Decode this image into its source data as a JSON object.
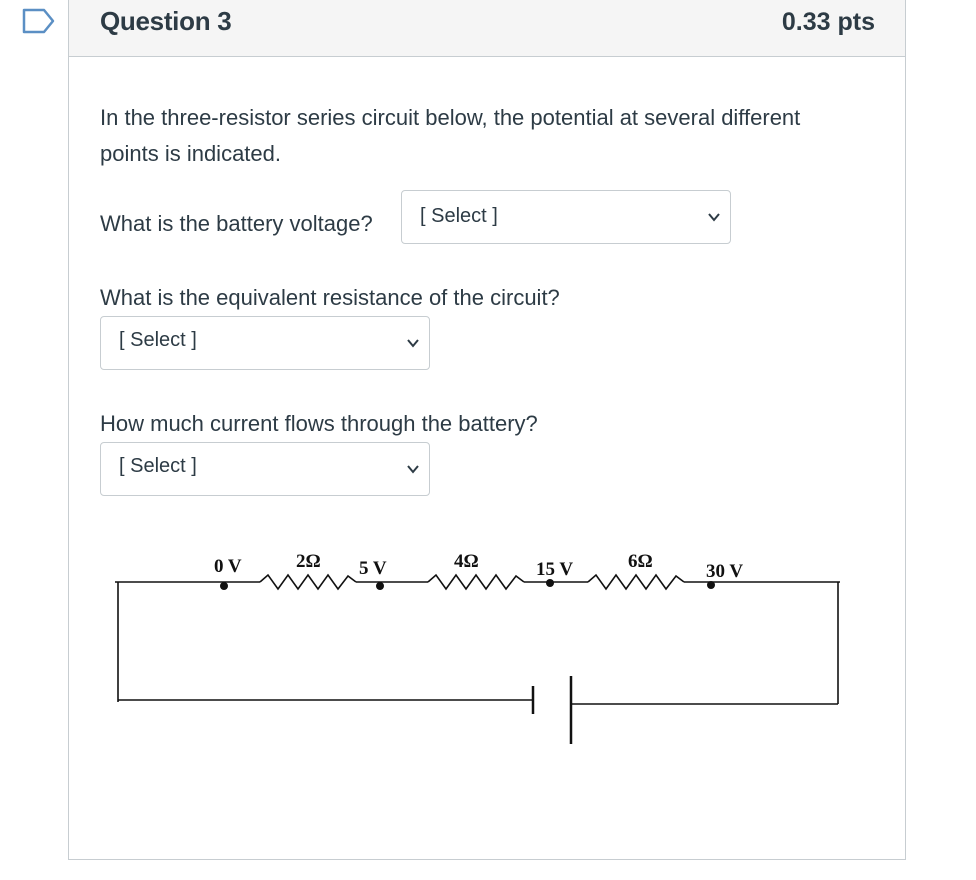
{
  "question": {
    "title": "Question 3",
    "points": "0.33 pts",
    "intro_line1": "In the three-resistor series circuit below, the potential at several different",
    "intro_line2": "points is indicated.",
    "q1": "What is the battery voltage?",
    "q2": "What is the equivalent resistance of the circuit?",
    "q3": "How much current flows through the battery?",
    "select_placeholder": "[ Select ]"
  },
  "circuit": {
    "labels": {
      "v0": "0 V",
      "r1": "2Ω",
      "v5": "5 V",
      "r2": "4Ω",
      "v15": "15 V",
      "r3": "6Ω",
      "v30": "30 V"
    }
  },
  "colors": {
    "text": "#2d3b45",
    "border": "#c7cdd1",
    "header_bg": "#f5f5f5",
    "flag": "#5b8fc4"
  }
}
